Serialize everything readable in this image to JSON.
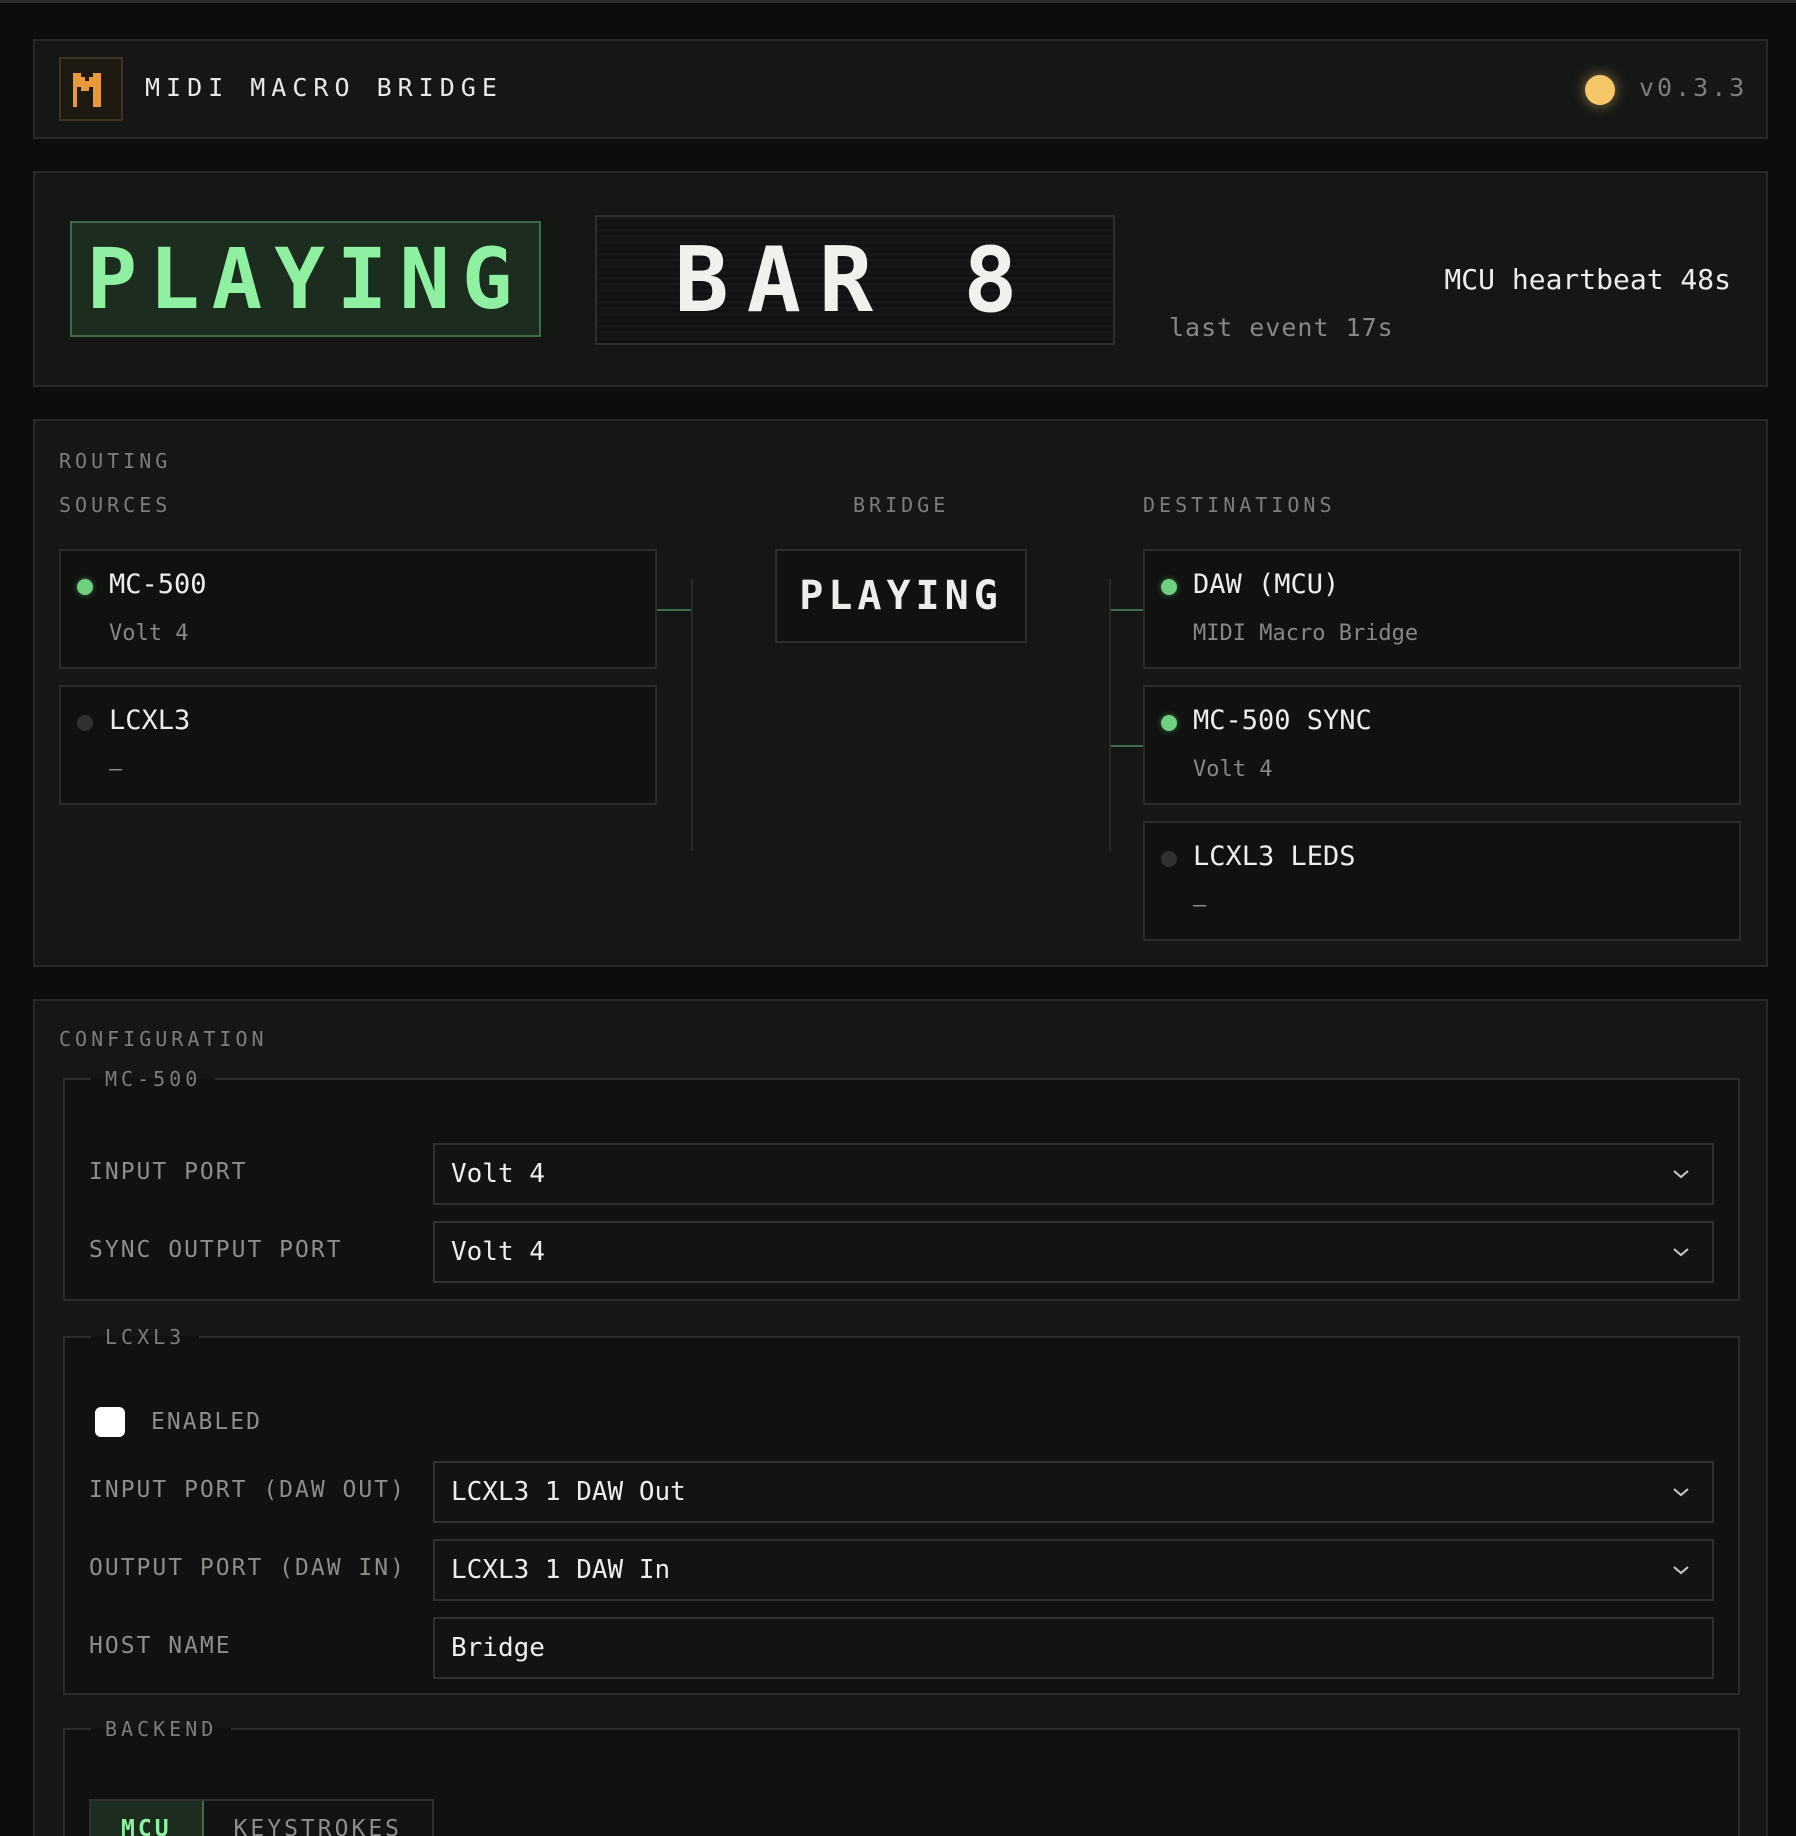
{
  "app": {
    "title": "MIDI MACRO BRIDGE",
    "logo_letter": "M",
    "version": "v0.3.3",
    "status_icon": "status-dot-icon",
    "status_color": "#f6c768"
  },
  "status": {
    "state": "PLAYING",
    "bar": "BAR 8",
    "heartbeat": "MCU heartbeat 48s",
    "last_event": "last event 17s"
  },
  "routing": {
    "title": "ROUTING",
    "sources_label": "SOURCES",
    "bridge_label": "BRIDGE",
    "destinations_label": "DESTINATIONS",
    "bridge_state": "PLAYING",
    "sources": [
      {
        "name": "MC-500",
        "port": "Volt 4",
        "active": true
      },
      {
        "name": "LCXL3",
        "port": "–",
        "active": false
      }
    ],
    "destinations": [
      {
        "name": "DAW (MCU)",
        "port": "MIDI Macro Bridge",
        "active": true
      },
      {
        "name": "MC-500 SYNC",
        "port": "Volt 4",
        "active": true
      },
      {
        "name": "LCXL3 LEDS",
        "port": "–",
        "active": false
      }
    ]
  },
  "config": {
    "title": "CONFIGURATION",
    "mc500": {
      "legend": "MC-500",
      "input_port_label": "INPUT PORT",
      "input_port_value": "Volt 4",
      "sync_output_label": "SYNC OUTPUT PORT",
      "sync_output_value": "Volt 4"
    },
    "lcxl3": {
      "legend": "LCXL3",
      "enabled_label": "ENABLED",
      "enabled": true,
      "input_port_label": "INPUT PORT (DAW OUT)",
      "input_port_value": "LCXL3 1 DAW Out",
      "output_port_label": "OUTPUT PORT (DAW IN)",
      "output_port_value": "LCXL3 1 DAW In",
      "host_name_label": "HOST NAME",
      "host_name_value": "Bridge"
    },
    "backend": {
      "legend": "BACKEND",
      "tabs": [
        "MCU",
        "KEYSTROKES"
      ],
      "active_tab": "MCU"
    }
  },
  "colors": {
    "accent_green": "#8ff0a2",
    "active_dot": "#6fd07f",
    "inactive_dot": "#2f322f",
    "logo_orange": "#e89a3a"
  }
}
